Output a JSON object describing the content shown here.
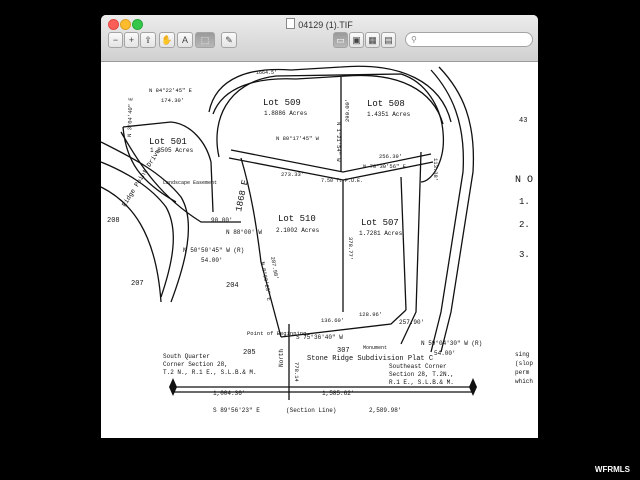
{
  "window": {
    "title": "04129 (1).TIF"
  },
  "toolbar": {
    "zoom_out": "−",
    "zoom_in": "+",
    "share": "⇪",
    "hand": "✋",
    "text_select": "A",
    "rect_select": "⬚",
    "annotate": "✎",
    "view_single": "▭",
    "view_double": "▣",
    "view_contact": "▦",
    "view_sheet": "▤",
    "search_placeholder": "⚲"
  },
  "map": {
    "lots": [
      {
        "name": "Lot 509",
        "area": "1.8886 Acres"
      },
      {
        "name": "Lot 508",
        "area": "1.4351 Acres"
      },
      {
        "name": "Lot 501",
        "area": "1.8505 Acres"
      },
      {
        "name": "Lot 510",
        "area": "2.1002 Acres"
      },
      {
        "name": "Lot 507",
        "area": "1.7281 Acres"
      }
    ],
    "bearings": {
      "n84": "N 84°22'45\" E",
      "d174": "174.30'",
      "n3": "N 3°04'40\" E",
      "d1664": "1664.5'",
      "n80": "N 80°17'45\" W",
      "d273": "273.33'",
      "d256": "256.39'",
      "n70": "N 70°30'56\" E",
      "d290": "290.00'",
      "n1": "N 1°21'54\" W",
      "d90": "90.00'",
      "n88": "N 88°00' W",
      "n50": "N 50°50'45\" W (R)",
      "d54": "54.00'",
      "d287": "287.98'",
      "n0": "N 0°00'23\" E",
      "d378": "378.77'",
      "d136": "136.60'",
      "d128": "128.96'",
      "s75": "S 75°36'40\" W",
      "d257": "257.90'",
      "n59": "N 59°04'30\" W (R)",
      "d54b": "54.00'",
      "d113": "113.38'",
      "d1004": "1,004.36'",
      "d1585": "1,585.62'",
      "s89": "S 89°56'23\" E",
      "section_line": "(Section Line)",
      "d2589": "2,589.98'",
      "d778": "778.14",
      "pue": "7.50 ft P.U.E.",
      "landscape": "Landscape Easement"
    },
    "road": "Ridge Point Drive",
    "neighbor_lots": [
      "208",
      "207",
      "204",
      "205",
      "307",
      "43"
    ],
    "monument": "Monument",
    "point_beg": "Point of Beginning",
    "north": "North",
    "street_e": "1868 E",
    "plat_title": "Stone Ridge Subdivision Plat C",
    "south_quarter": [
      "South Quarter",
      "Corner Section 28,",
      "T.2 N., R.1 E., S.L.B.& M."
    ],
    "southeast": [
      "Southeast Corner",
      "Section 28, T.2N.,",
      "R.1 E., S.L.B.& M."
    ],
    "notes": {
      "header": "N O",
      "items": [
        "1.",
        "2.",
        "3."
      ]
    },
    "right_text": [
      "sing",
      "(slop",
      "perm",
      "which"
    ]
  },
  "watermark": "WFRMLS"
}
